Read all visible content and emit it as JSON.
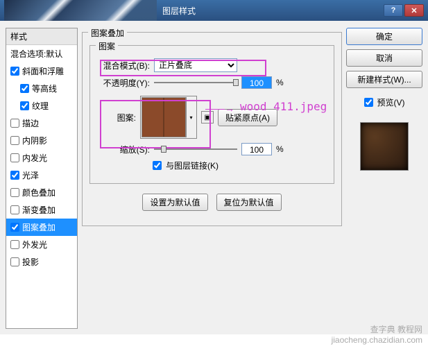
{
  "titlebar": {
    "title": "图层样式"
  },
  "styles_panel": {
    "header": "样式",
    "blend_options": "混合选项:默认",
    "items": [
      {
        "label": "斜面和浮雕",
        "checked": true,
        "sub": false
      },
      {
        "label": "等高线",
        "checked": true,
        "sub": true
      },
      {
        "label": "纹理",
        "checked": true,
        "sub": true
      },
      {
        "label": "描边",
        "checked": false,
        "sub": false
      },
      {
        "label": "内阴影",
        "checked": false,
        "sub": false
      },
      {
        "label": "内发光",
        "checked": false,
        "sub": false
      },
      {
        "label": "光泽",
        "checked": true,
        "sub": false
      },
      {
        "label": "颜色叠加",
        "checked": false,
        "sub": false
      },
      {
        "label": "渐变叠加",
        "checked": false,
        "sub": false
      },
      {
        "label": "图案叠加",
        "checked": true,
        "sub": false,
        "selected": true
      },
      {
        "label": "外发光",
        "checked": false,
        "sub": false
      },
      {
        "label": "投影",
        "checked": false,
        "sub": false
      }
    ]
  },
  "center": {
    "group_title": "图案叠加",
    "inner_title": "图案",
    "blend_mode_label": "混合模式(B):",
    "blend_mode_value": "正片叠底",
    "opacity_label": "不透明度(Y):",
    "opacity_value": "100",
    "pct": "%",
    "pattern_label": "图案:",
    "snap_origin": "贴紧原点(A)",
    "scale_label": "缩放(S):",
    "scale_value": "100",
    "link_label": "与图层链接(K)",
    "link_checked": true,
    "default_btn": "设置为默认值",
    "reset_btn": "复位为默认值"
  },
  "right": {
    "ok": "确定",
    "cancel": "取消",
    "new_style": "新建样式(W)...",
    "preview_label": "预览(V)",
    "preview_checked": true
  },
  "annotation": {
    "text": "wood 411.jpeg"
  },
  "watermark": {
    "line1": "查字典 教程网",
    "line2": "jiaocheng.chazidian.com"
  }
}
